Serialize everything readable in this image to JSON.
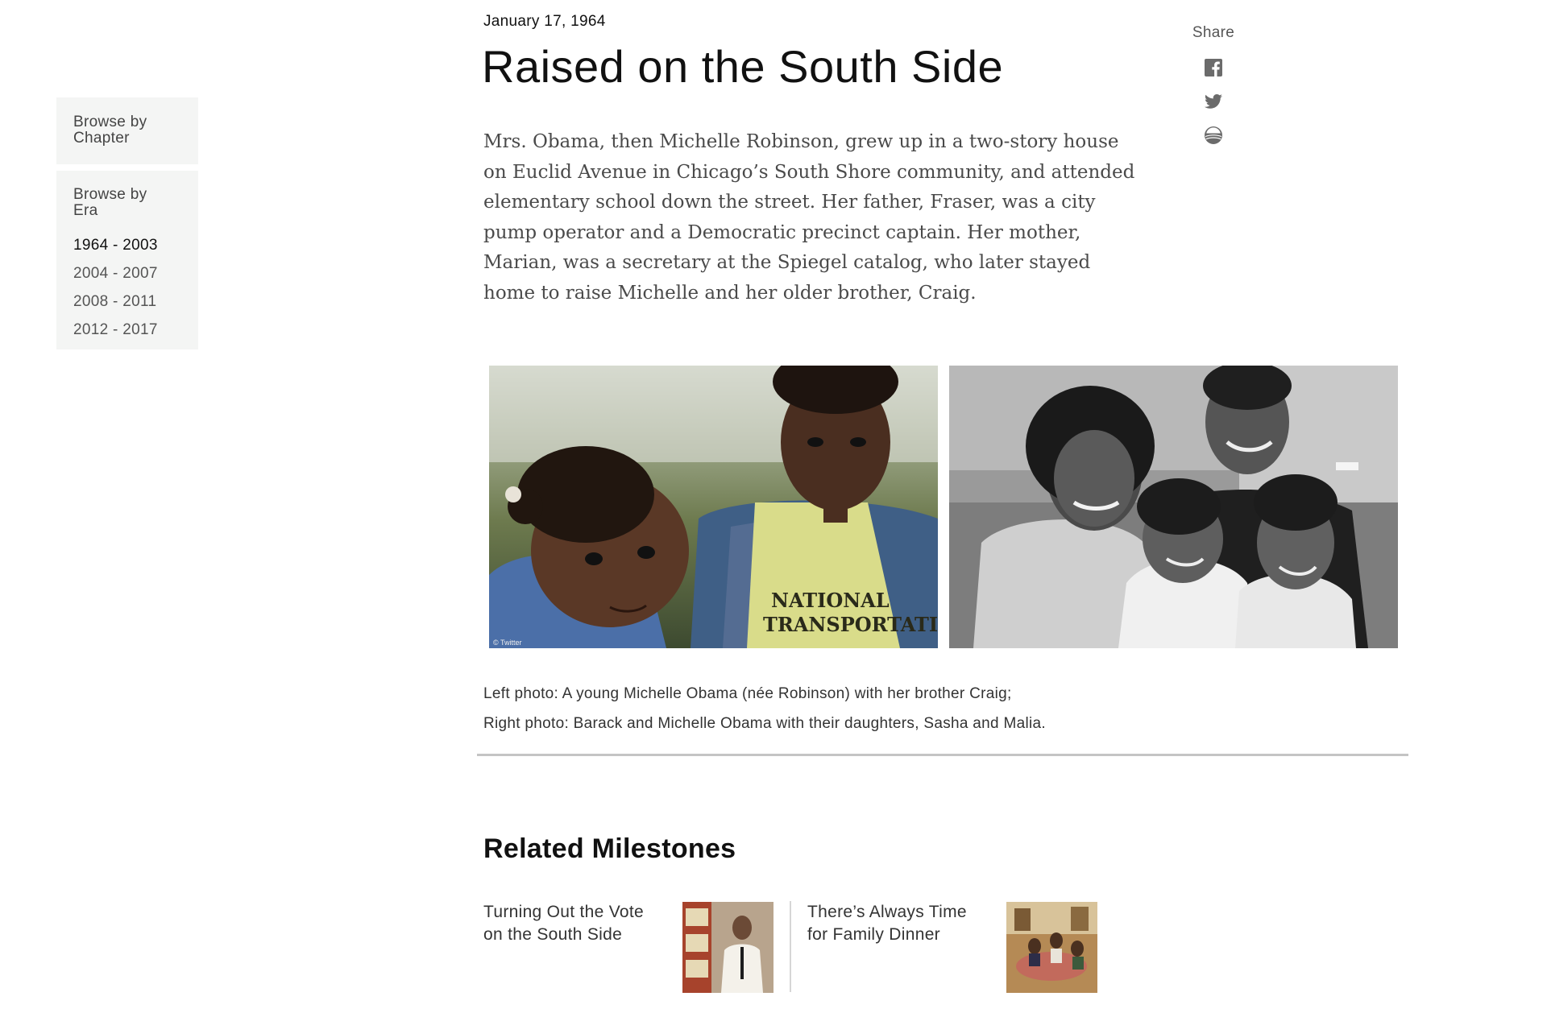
{
  "sidebar": {
    "chapter_title": "Browse by Chapter",
    "era_title": "Browse by Era",
    "eras": [
      {
        "label": "1964 - 2003",
        "active": true
      },
      {
        "label": "2004 - 2007",
        "active": false
      },
      {
        "label": "2008 - 2011",
        "active": false
      },
      {
        "label": "2012 - 2017",
        "active": false
      }
    ]
  },
  "article": {
    "date": "January 17, 1964",
    "title": "Raised on the South Side",
    "body": "Mrs. Obama, then Michelle Robinson, grew up in a two-story house on Euclid Avenue in Chicago’s South Shore community, and attended elementary school down the street. Her father, Fraser, was a city pump operator and a Democratic precinct captain. Her mother, Marian, was a secretary at the Spiegel catalog, who later stayed home to raise Michelle and her older brother, Craig.",
    "photo_left_credit": "© Twitter",
    "caption_line1": "Left photo: A young Michelle Obama (née Robinson) with her brother Craig;",
    "caption_line2": "Right photo: Barack and Michelle Obama with their daughters, Sasha and Malia."
  },
  "share": {
    "label": "Share",
    "icons": [
      "facebook-icon",
      "twitter-icon",
      "obama-logo-icon"
    ],
    "icon_color": "#6b6b6b"
  },
  "related": {
    "heading": "Related Milestones",
    "items": [
      {
        "title": "Turning Out the Vote on the South Side"
      },
      {
        "title": "There’s Always Time for Family Dinner"
      }
    ]
  }
}
